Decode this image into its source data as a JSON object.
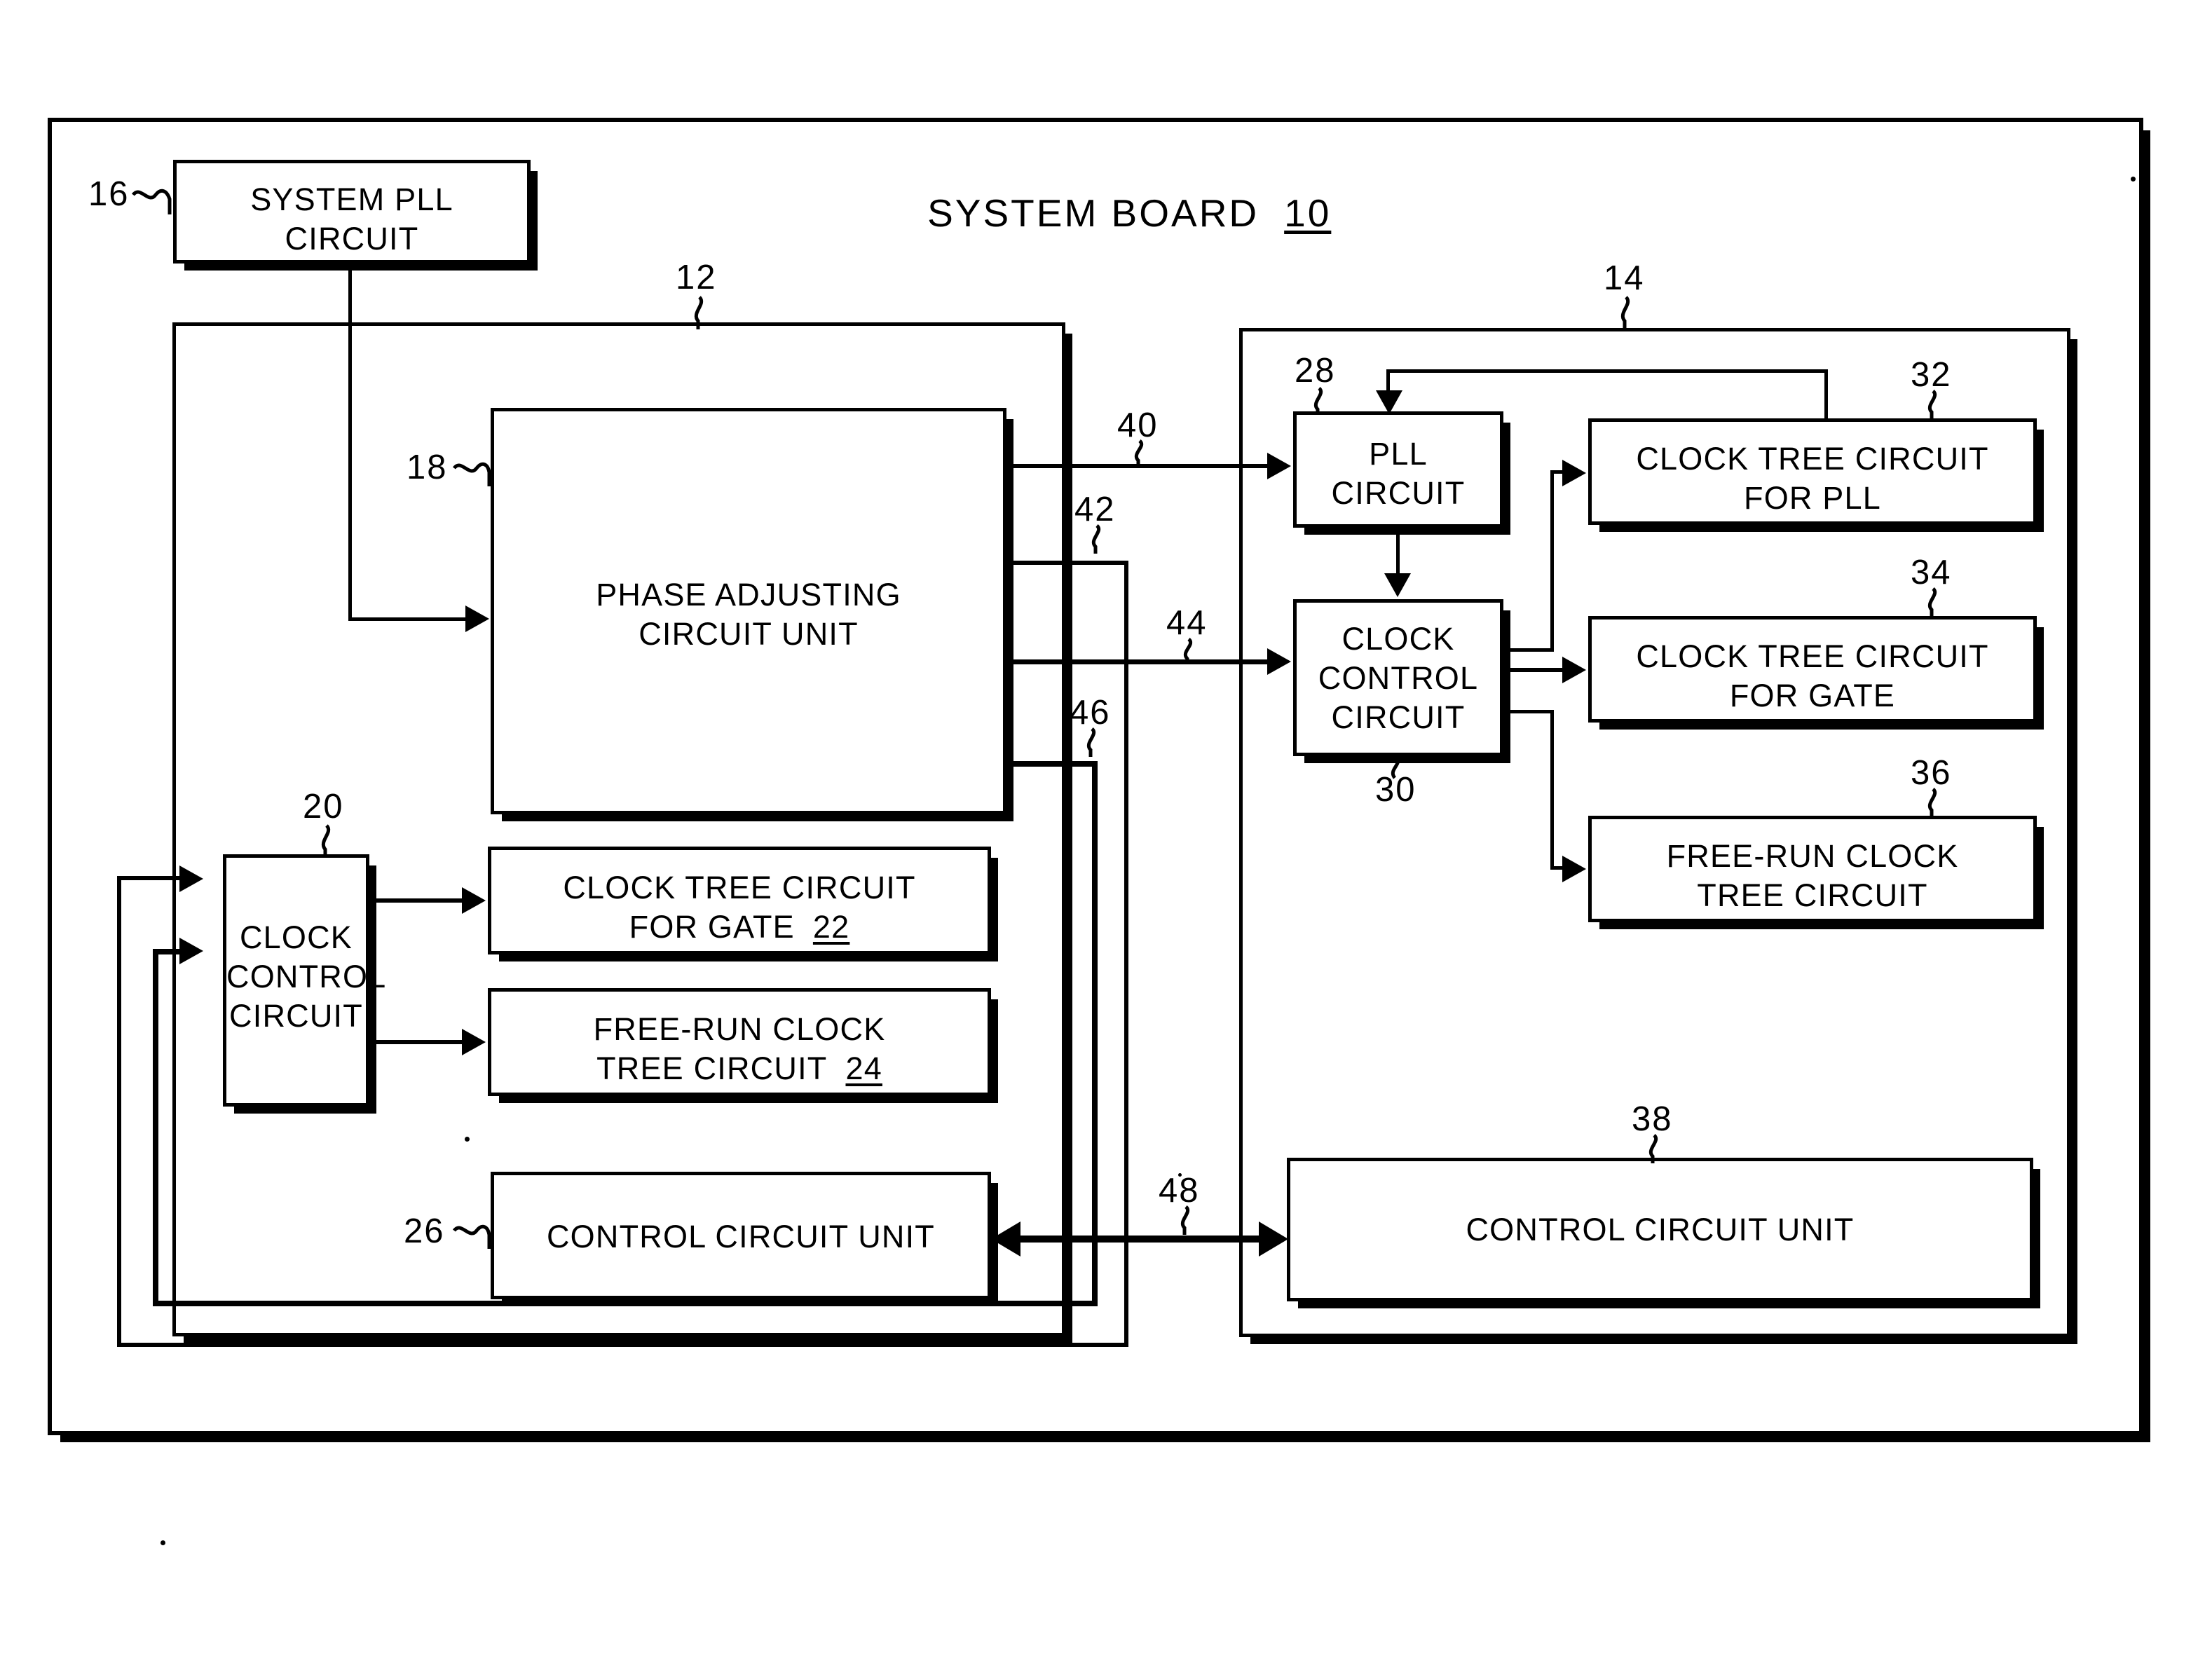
{
  "figure": {
    "title": "SYSTEM BOARD",
    "title_ref": "10"
  },
  "blocks": {
    "system_pll": {
      "line1": "SYSTEM PLL",
      "line2": "CIRCUIT",
      "ref": "16"
    },
    "left_board": {
      "ref": "12"
    },
    "right_board": {
      "ref": "14"
    },
    "phase_adjusting": {
      "line1": "PHASE ADJUSTING",
      "line2": "CIRCUIT UNIT",
      "ref": "18"
    },
    "left_clock_control": {
      "line1": "CLOCK",
      "line2": "CONTROL",
      "line3": "CIRCUIT",
      "ref": "20"
    },
    "left_clock_tree_gate": {
      "line1": "CLOCK TREE CIRCUIT",
      "line2": "FOR GATE",
      "inline_ref": "22"
    },
    "left_free_run_tree": {
      "line1": "FREE-RUN CLOCK",
      "line2": "TREE CIRCUIT",
      "inline_ref": "24"
    },
    "left_control_unit": {
      "line1": "CONTROL CIRCUIT UNIT",
      "ref": "26"
    },
    "right_pll": {
      "line1": "PLL",
      "line2": "CIRCUIT",
      "ref": "28"
    },
    "right_clock_control": {
      "line1": "CLOCK",
      "line2": "CONTROL",
      "line3": "CIRCUIT",
      "ref": "30"
    },
    "right_clock_tree_pll": {
      "line1": "CLOCK TREE CIRCUIT",
      "line2": "FOR PLL",
      "ref": "32"
    },
    "right_clock_tree_gate": {
      "line1": "CLOCK TREE CIRCUIT",
      "line2": "FOR GATE",
      "ref": "34"
    },
    "right_free_run_tree": {
      "line1": "FREE-RUN CLOCK",
      "line2": "TREE CIRCUIT",
      "ref": "36"
    },
    "right_control_unit": {
      "line1": "CONTROL CIRCUIT UNIT",
      "ref": "38"
    }
  },
  "signals": {
    "s40": "40",
    "s42": "42",
    "s44": "44",
    "s46": "46",
    "s48": "48"
  }
}
